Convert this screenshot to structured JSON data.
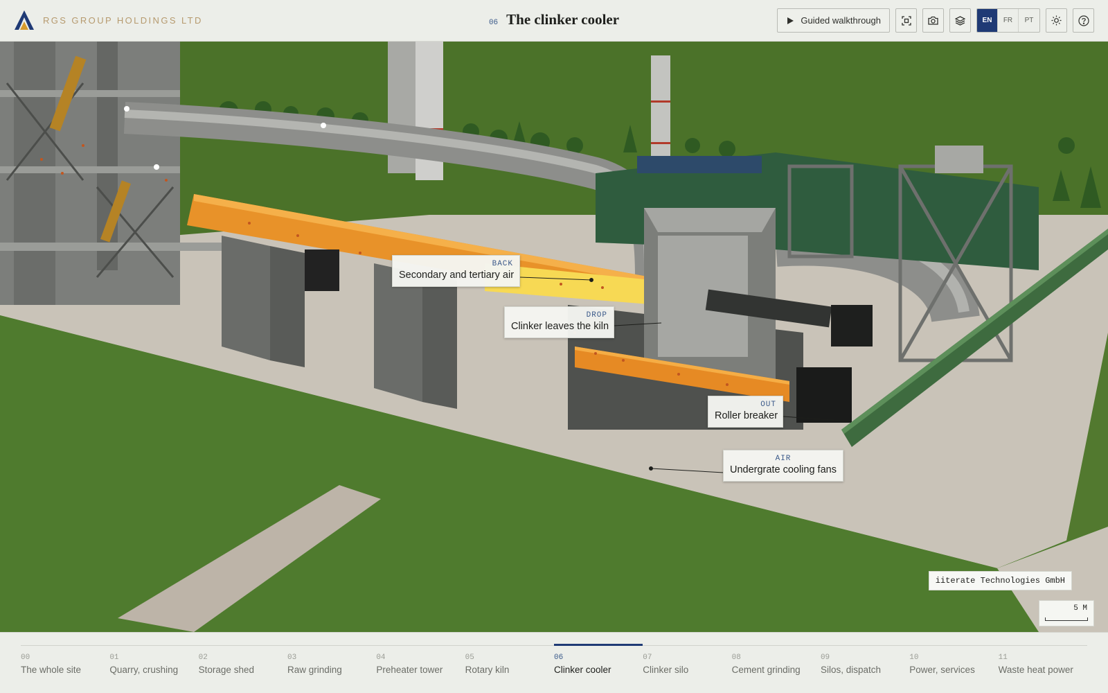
{
  "brand": {
    "name": "RGS GROUP HOLDINGS LTD",
    "logo": "rgs-logo"
  },
  "header": {
    "section_number": "06",
    "title": "The clinker cooler",
    "walkthrough_label": "Guided walkthrough",
    "icons": [
      "play-icon",
      "focus-icon",
      "camera-icon",
      "layers-icon",
      "sun-icon",
      "help-icon"
    ],
    "languages": [
      {
        "code": "EN",
        "active": true
      },
      {
        "code": "FR",
        "active": false
      },
      {
        "code": "PT",
        "active": false
      }
    ]
  },
  "callouts": [
    {
      "tag": "BACK",
      "label": "Secondary and tertiary air"
    },
    {
      "tag": "DROP",
      "label": "Clinker leaves the kiln"
    },
    {
      "tag": "OUT",
      "label": "Roller breaker"
    },
    {
      "tag": "AIR",
      "label": "Undergrate cooling fans"
    }
  ],
  "credit": "iiterate Technologies GmbH",
  "scale": {
    "label": "5 M"
  },
  "timeline": {
    "active_index": 6,
    "steps": [
      {
        "num": "00",
        "label": "The whole site"
      },
      {
        "num": "01",
        "label": "Quarry, crushing"
      },
      {
        "num": "02",
        "label": "Storage shed"
      },
      {
        "num": "03",
        "label": "Raw grinding"
      },
      {
        "num": "04",
        "label": "Preheater tower"
      },
      {
        "num": "05",
        "label": "Rotary kiln"
      },
      {
        "num": "06",
        "label": "Clinker cooler"
      },
      {
        "num": "07",
        "label": "Clinker silo"
      },
      {
        "num": "08",
        "label": "Cement grinding"
      },
      {
        "num": "09",
        "label": "Silos, dispatch"
      },
      {
        "num": "10",
        "label": "Power, services"
      },
      {
        "num": "11",
        "label": "Waste heat power"
      }
    ]
  },
  "colors": {
    "accent": "#1f3a75",
    "brand_gold": "#b69a6e",
    "kiln_glow": "#f2a133",
    "grass": "#4e7a30"
  }
}
